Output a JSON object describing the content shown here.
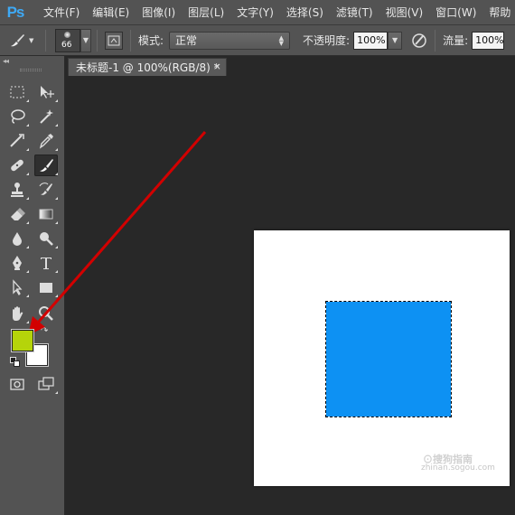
{
  "app": {
    "logo": "Ps"
  },
  "menu": [
    "文件(F)",
    "编辑(E)",
    "图像(I)",
    "图层(L)",
    "文字(Y)",
    "选择(S)",
    "滤镜(T)",
    "视图(V)",
    "窗口(W)",
    "帮助"
  ],
  "options": {
    "brush_size": "66",
    "mode_label": "模式:",
    "mode_value": "正常",
    "opacity_label": "不透明度:",
    "opacity_value": "100%",
    "flow_label": "流量:",
    "flow_value": "100%"
  },
  "toolbar": {
    "collapse": "◂◂",
    "foreground_color": "#b5d40a",
    "background_color": "#ffffff",
    "active_tool": "brush-tool"
  },
  "document": {
    "tab_title": "未标题-1 @ 100%(RGB/8) *",
    "close": "×",
    "fill_color": "#0d91f3"
  },
  "annotation": {
    "arrow_color": "#d20000",
    "arrow_target": "foreground-color-swatch"
  },
  "watermark": {
    "logo": "⊙搜狗指南",
    "url": "zhinan.sogou.com"
  }
}
